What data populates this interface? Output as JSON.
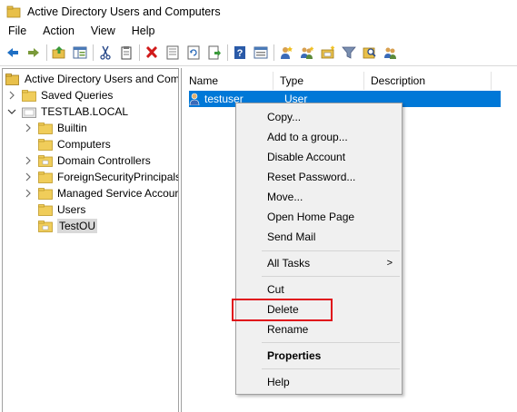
{
  "window": {
    "title": "Active Directory Users and Computers"
  },
  "menubar": {
    "items": [
      "File",
      "Action",
      "View",
      "Help"
    ]
  },
  "toolbar": {
    "buttons": [
      "back-icon",
      "forward-icon",
      "up-folder-icon",
      "show-tree-icon",
      "cut-icon",
      "copy-icon",
      "delete-icon",
      "properties-icon",
      "refresh-icon",
      "export-list-icon",
      "help-icon",
      "console-tree-icon",
      "new-user-icon",
      "new-group-icon",
      "new-ou-icon",
      "filter-icon",
      "find-icon",
      "add-to-group-icon"
    ]
  },
  "tree": {
    "root": "Active Directory Users and Com",
    "items": [
      {
        "label": "Saved Queries",
        "level": 1,
        "expander": ">"
      },
      {
        "label": "TESTLAB.LOCAL",
        "level": 1,
        "expander": "v"
      },
      {
        "label": "Builtin",
        "level": 2,
        "expander": ">"
      },
      {
        "label": "Computers",
        "level": 2,
        "expander": ""
      },
      {
        "label": "Domain Controllers",
        "level": 2,
        "expander": ">"
      },
      {
        "label": "ForeignSecurityPrincipals",
        "level": 2,
        "expander": ">"
      },
      {
        "label": "Managed Service Accour",
        "level": 2,
        "expander": ">"
      },
      {
        "label": "Users",
        "level": 2,
        "expander": ""
      },
      {
        "label": "TestOU",
        "level": 2,
        "expander": "",
        "selected": true
      }
    ]
  },
  "list": {
    "columns": [
      "Name",
      "Type",
      "Description"
    ],
    "rows": [
      {
        "name": "testuser",
        "type": "User",
        "description": ""
      }
    ]
  },
  "context_menu": {
    "items": [
      {
        "label": "Copy...",
        "bold": false
      },
      {
        "label": "Add to a group...",
        "bold": false
      },
      {
        "label": "Disable Account",
        "bold": false
      },
      {
        "label": "Reset Password...",
        "bold": false
      },
      {
        "label": "Move...",
        "bold": false
      },
      {
        "label": "Open Home Page",
        "bold": false
      },
      {
        "label": "Send Mail",
        "bold": false
      },
      {
        "label": "All Tasks",
        "bold": false,
        "submenu": true
      },
      {
        "label": "Cut",
        "bold": false
      },
      {
        "label": "Delete",
        "bold": false,
        "highlighted": true
      },
      {
        "label": "Rename",
        "bold": false
      },
      {
        "label": "Properties",
        "bold": true
      },
      {
        "label": "Help",
        "bold": false
      }
    ],
    "submenu_arrow": ">"
  },
  "colors": {
    "selection": "#0078d7",
    "highlight_box": "#e0101a",
    "folder": "#e8c04a"
  }
}
